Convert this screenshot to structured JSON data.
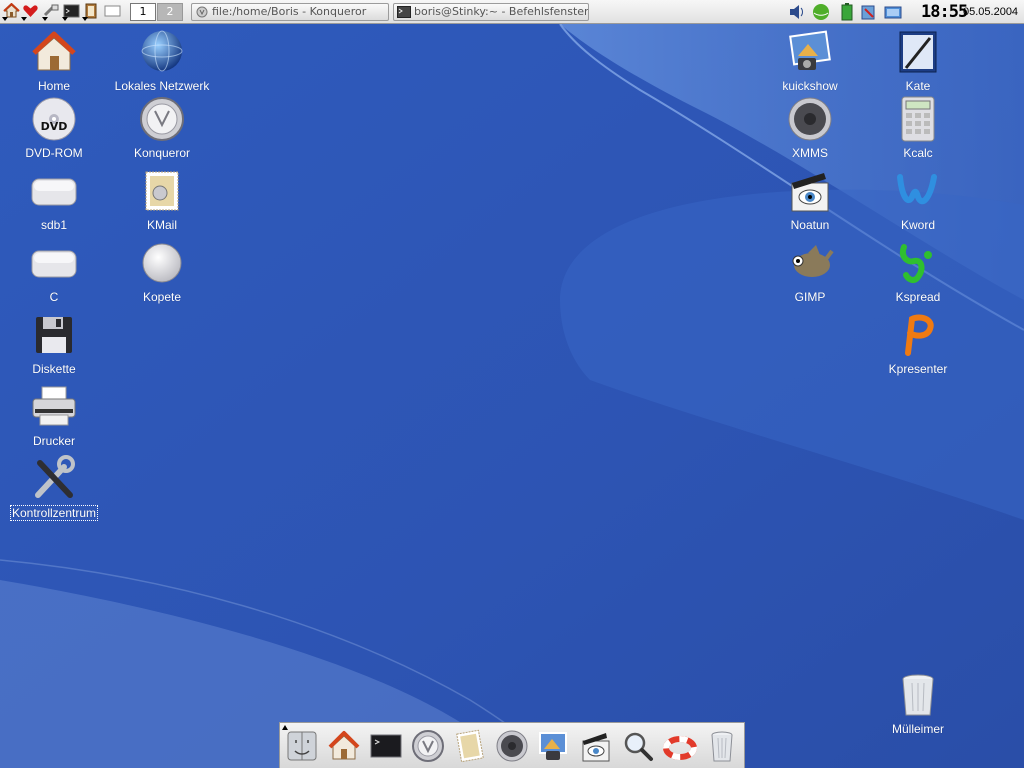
{
  "panel": {
    "pager": [
      "1",
      "2"
    ],
    "tasks": [
      {
        "label": "file:/home/Boris - Konqueror",
        "icon": "konqueror-icon"
      },
      {
        "label": "boris@Stinky:~ - Befehlsfenster",
        "icon": "terminal-icon"
      }
    ],
    "tray_icons": [
      "speaker-icon",
      "network-globe-icon",
      "battery-icon",
      "klipper-icon",
      "display-icon"
    ],
    "clock": {
      "time": "18:55",
      "date": "05.05.2004"
    }
  },
  "desktop": {
    "left_icons": [
      {
        "label": "Home",
        "icon": "home-icon"
      },
      {
        "label": "Lokales Netzwerk",
        "icon": "network-globe-icon"
      },
      {
        "label": "DVD-ROM",
        "icon": "dvd-icon"
      },
      {
        "label": "Konqueror",
        "icon": "konqueror-icon"
      },
      {
        "label": "sdb1",
        "icon": "hard-drive-icon"
      },
      {
        "label": "KMail",
        "icon": "mail-stamp-icon"
      },
      {
        "label": "C",
        "icon": "hard-drive-icon"
      },
      {
        "label": "Kopete",
        "icon": "kopete-icon"
      },
      {
        "label": "Diskette",
        "icon": "floppy-icon"
      },
      {
        "label": "Drucker",
        "icon": "printer-icon"
      },
      {
        "label": "Kontrollzentrum",
        "icon": "tools-icon"
      }
    ],
    "right_icons": [
      {
        "label": "kuickshow",
        "icon": "photo-camera-icon"
      },
      {
        "label": "Kate",
        "icon": "kate-editor-icon"
      },
      {
        "label": "XMMS",
        "icon": "speaker-icon"
      },
      {
        "label": "Kcalc",
        "icon": "calculator-icon"
      },
      {
        "label": "Noatun",
        "icon": "clapper-eye-icon"
      },
      {
        "label": "Kword",
        "icon": "kword-icon"
      },
      {
        "label": "GIMP",
        "icon": "gimp-icon"
      },
      {
        "label": "Kspread",
        "icon": "kspread-icon"
      },
      {
        "label": "Kpresenter",
        "icon": "kpresenter-icon"
      },
      {
        "label": "Mülleimer",
        "icon": "trash-icon"
      }
    ]
  },
  "dock": {
    "items": [
      "finder-face-icon",
      "home-icon",
      "terminal-icon",
      "konqueror-icon",
      "mail-stamp-icon",
      "speaker-icon",
      "photo-camera-icon",
      "clapper-eye-icon",
      "search-icon",
      "lifebuoy-icon",
      "trash-icon"
    ]
  },
  "colors": {
    "desktop_blue": "#3159b8",
    "panel_gray": "#e6e6e6"
  }
}
